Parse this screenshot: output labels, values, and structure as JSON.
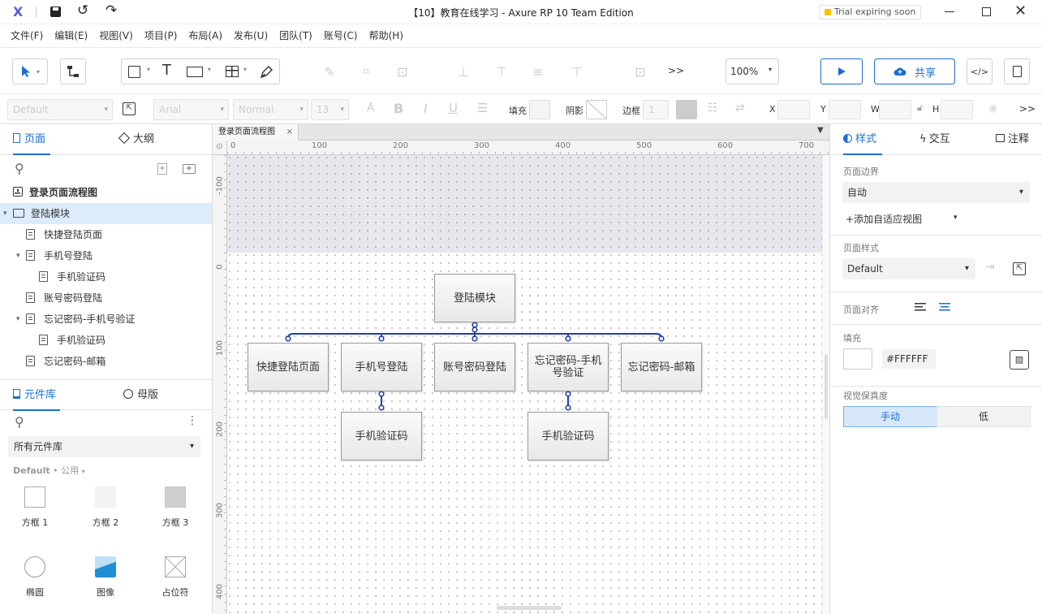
{
  "app": {
    "logo": "X",
    "title": "【10】教育在线学习 - Axure RP 10 Team Edition",
    "trial_badge": "Trial expiring soon"
  },
  "menu": [
    "文件(F)",
    "编辑(E)",
    "视图(V)",
    "项目(P)",
    "布局(A)",
    "发布(U)",
    "团队(T)",
    "账号(C)",
    "帮助(H)"
  ],
  "toolbar": {
    "zoom": "100%",
    "more": ">>",
    "share_label": "共享"
  },
  "format": {
    "style_select": "Default",
    "font_select": "Arial",
    "weight_select": "Normal",
    "size_select": "13",
    "fill_label": "填充",
    "shadow_label": "阴影",
    "border_label": "边框",
    "border_value": "1",
    "x_label": "X",
    "y_label": "Y",
    "w_label": "W",
    "h_label": "H",
    "more": ">>"
  },
  "left": {
    "tab_pages": "页面",
    "tab_outline": "大纲",
    "root": "登录页面流程图",
    "tree": [
      {
        "label": "登陆模块",
        "level": 0,
        "type": "folder",
        "toggle": "▾",
        "selected": true
      },
      {
        "label": "快捷登陆页面",
        "level": 1,
        "type": "page",
        "toggle": ""
      },
      {
        "label": "手机号登陆",
        "level": 1,
        "type": "page",
        "toggle": "▾"
      },
      {
        "label": "手机验证码",
        "level": 2,
        "type": "page",
        "toggle": ""
      },
      {
        "label": "账号密码登陆",
        "level": 1,
        "type": "page",
        "toggle": ""
      },
      {
        "label": "忘记密码-手机号验证",
        "level": 1,
        "type": "page",
        "toggle": "▾"
      },
      {
        "label": "手机验证码",
        "level": 2,
        "type": "page",
        "toggle": ""
      },
      {
        "label": "忘记密码-邮箱",
        "level": 1,
        "type": "page",
        "toggle": ""
      }
    ],
    "tab_library": "元件库",
    "tab_masters": "母版",
    "library_select": "所有元件库",
    "library_path_a": "Default",
    "library_path_b": "公用",
    "widgets": [
      {
        "label": "方框 1",
        "kind": "box1"
      },
      {
        "label": "方框 2",
        "kind": "box2"
      },
      {
        "label": "方框 3",
        "kind": "box3"
      },
      {
        "label": "椭圆",
        "kind": "ellipse"
      },
      {
        "label": "图像",
        "kind": "image"
      },
      {
        "label": "占位符",
        "kind": "placeholder"
      }
    ]
  },
  "canvas": {
    "tab_label": "登录页面流程图",
    "ruler_top": [
      "0",
      "100",
      "200",
      "300",
      "400",
      "500",
      "600",
      "700"
    ],
    "ruler_left": [
      "-100",
      "0",
      "100",
      "200",
      "300",
      "400"
    ],
    "nodes": {
      "root": "登陆模块",
      "n1": "快捷登陆页面",
      "n2": "手机号登陆",
      "n3": "账号密码登陆",
      "n4": "忘记密码-手机号验证",
      "n5": "忘记密码-邮箱",
      "n2a": "手机验证码",
      "n4a": "手机验证码"
    }
  },
  "right": {
    "tab_style": "样式",
    "tab_interact": "交互",
    "tab_notes": "注释",
    "page_dims_label": "页面边界",
    "page_dims_value": "自动",
    "add_adaptive": "添加自适应视图",
    "page_style_label": "页面样式",
    "page_style_value": "Default",
    "page_align_label": "页面对齐",
    "fill_label": "填充",
    "fill_value": "#FFFFFF",
    "fidelity_label": "视觉保真度",
    "fidelity_manual": "手动",
    "fidelity_low": "低"
  },
  "colors": {
    "accent": "#1a6fd0",
    "connector": "#1f3fa8",
    "selected_bg": "#dcecfb"
  }
}
